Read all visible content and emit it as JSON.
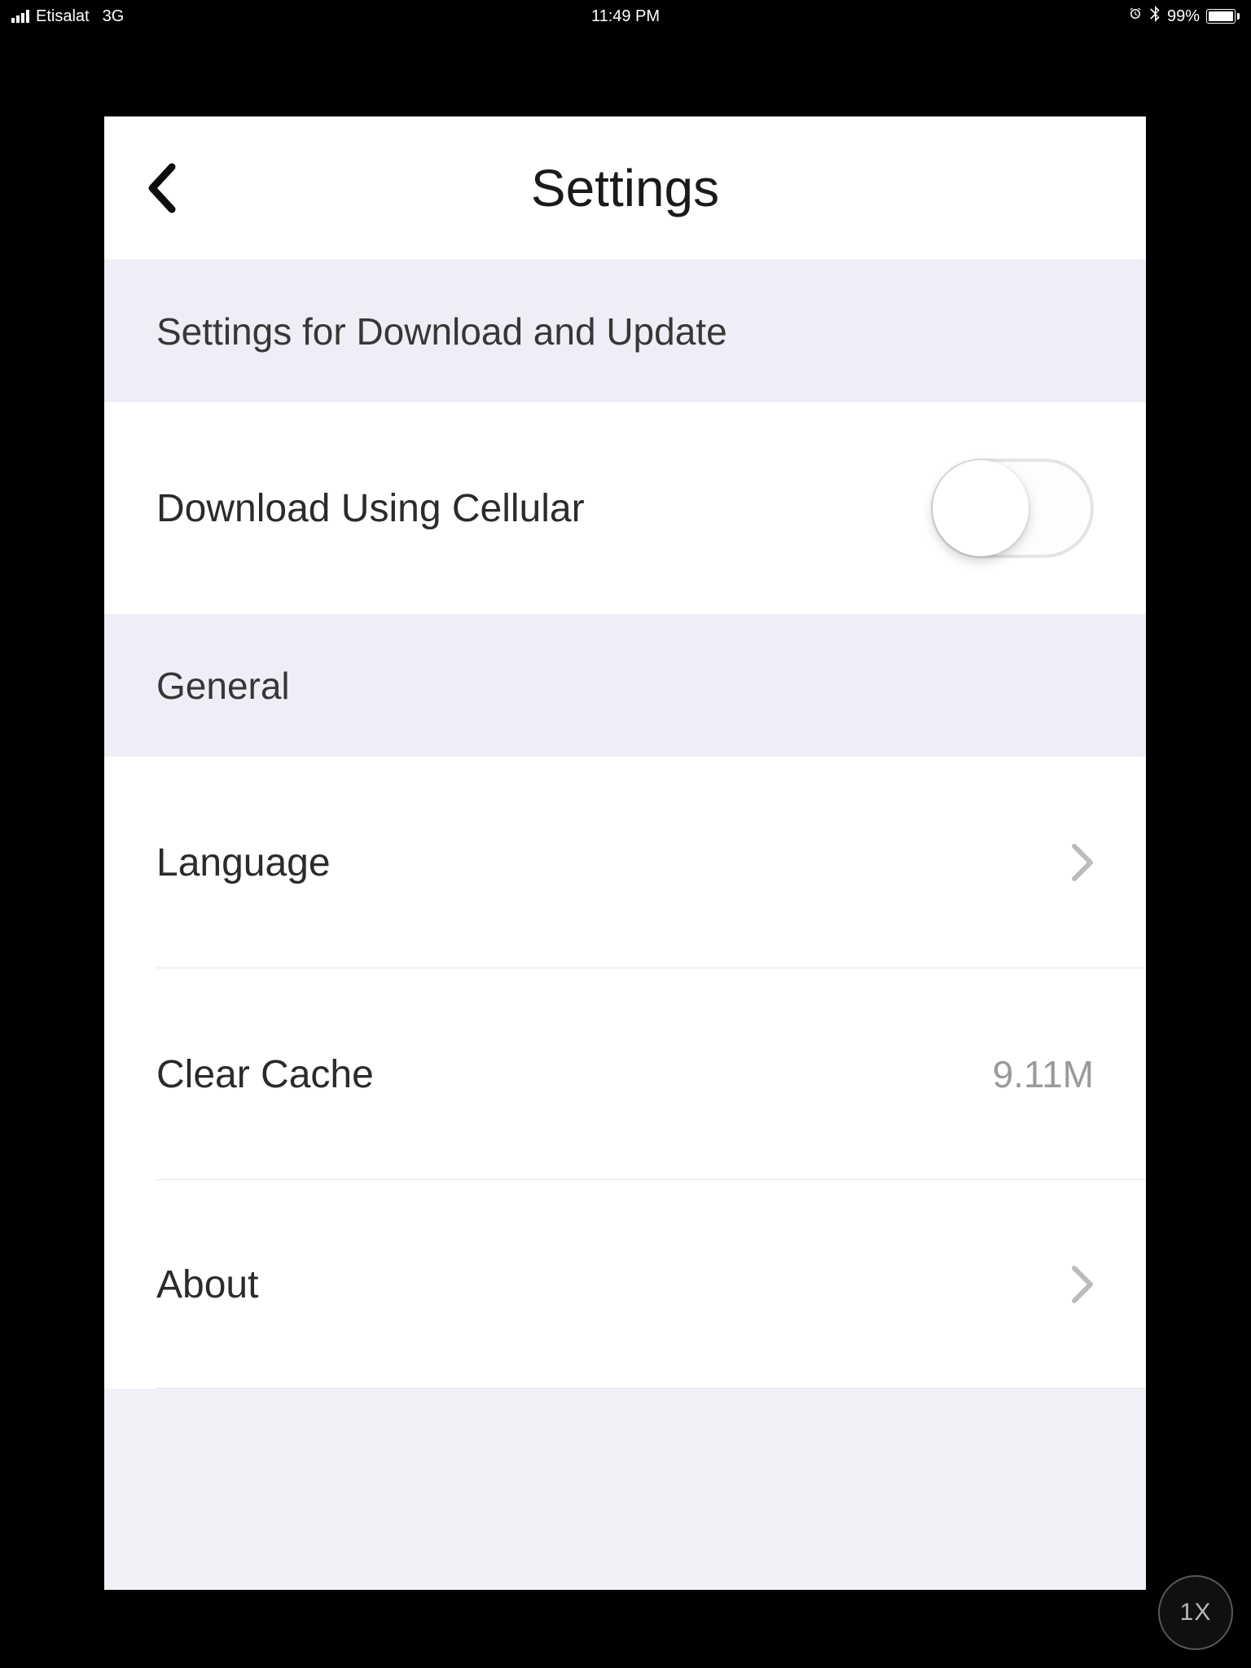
{
  "status_bar": {
    "carrier": "Etisalat",
    "network": "3G",
    "time": "11:49 PM",
    "battery_percent": "99%"
  },
  "header": {
    "title": "Settings"
  },
  "sections": {
    "download_update_header": "Settings for Download and Update",
    "download_cellular_label": "Download Using Cellular",
    "general_header": "General",
    "language_label": "Language",
    "clear_cache_label": "Clear Cache",
    "clear_cache_value": "9.11M",
    "about_label": "About"
  },
  "floating_badge_label": "1X"
}
